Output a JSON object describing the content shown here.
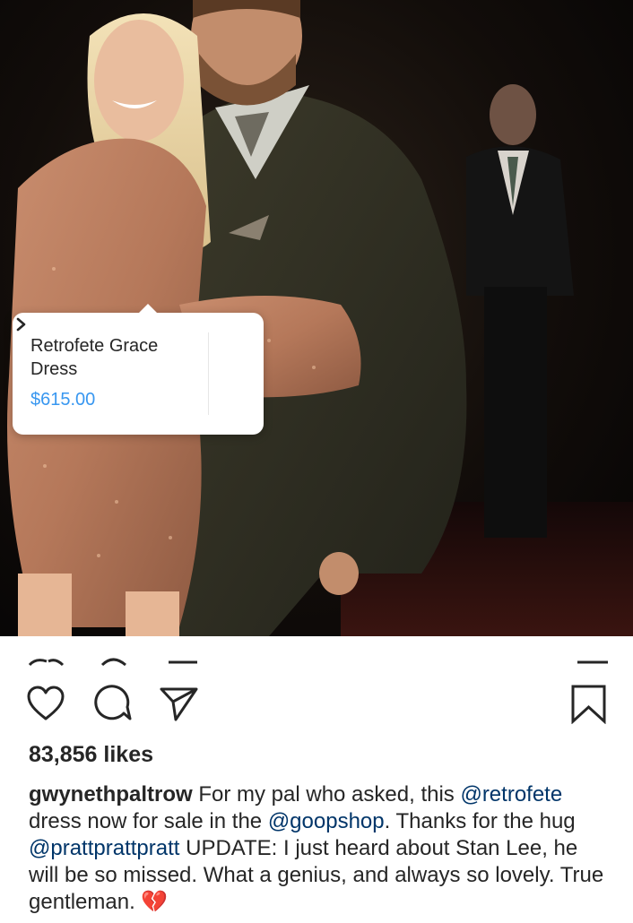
{
  "post": {
    "product_tag": {
      "name": "Retrofete Grace Dress",
      "price": "$615.00"
    },
    "likes": "83,856 likes",
    "caption": {
      "username": "gwynethpaltrow",
      "text_1": " For my pal who asked, this ",
      "mention_1": "@retrofete",
      "text_2": " dress now for sale in the ",
      "mention_2": "@goopshop",
      "text_3": ". Thanks for the hug ",
      "mention_3": "@prattprattpratt",
      "text_4": " UPDATE: I just heard about Stan Lee, he will be so missed. What a genius, and always so lovely. True gentleman. ",
      "emoji": "💔"
    }
  },
  "icons": {
    "like": "heart-icon",
    "comment": "comment-icon",
    "share": "direct-share-icon",
    "save": "bookmark-icon",
    "tag_arrow": "chevron-right-icon"
  },
  "colors": {
    "link": "#003569",
    "price": "#3897f0",
    "text": "#262626"
  }
}
